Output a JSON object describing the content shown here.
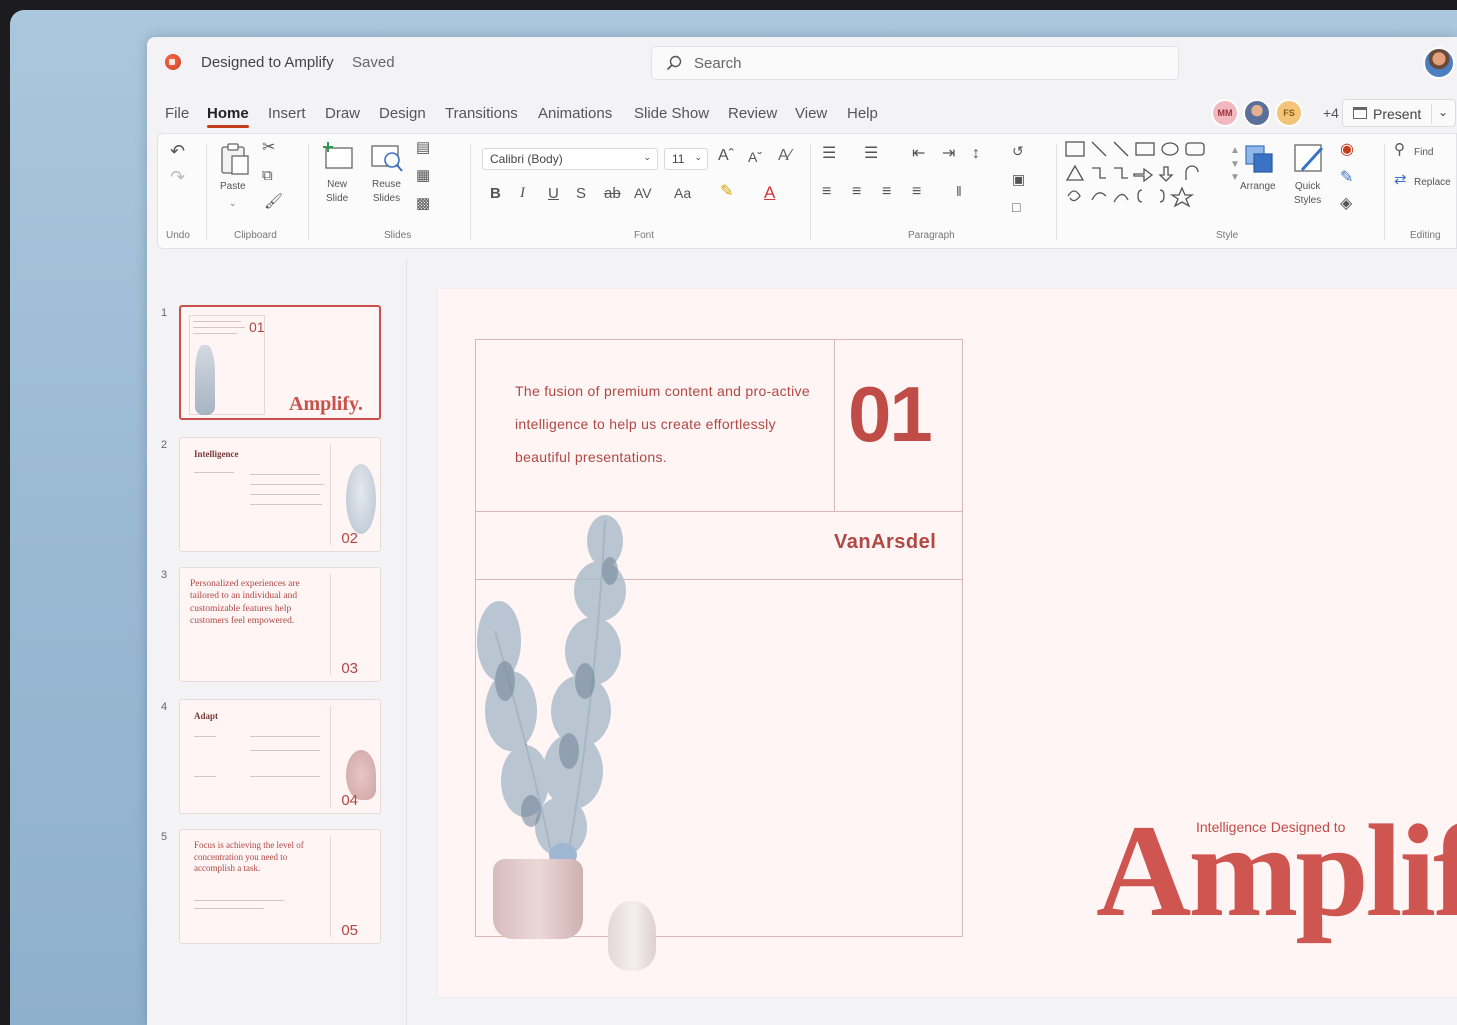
{
  "title_bar": {
    "document_title": "Designed to Amplify",
    "save_status": "Saved",
    "search_placeholder": "Search"
  },
  "tabs": [
    "File",
    "Home",
    "Insert",
    "Draw",
    "Design",
    "Transitions",
    "Animations",
    "Slide Show",
    "Review",
    "View",
    "Help"
  ],
  "active_tab": "Home",
  "collaborators": {
    "items": [
      {
        "initials": "MM",
        "color": "#f1b9bf"
      },
      {
        "initials": "",
        "color": "#9bb7e0"
      },
      {
        "initials": "FS",
        "color": "#f3c47a"
      }
    ],
    "more": "+4"
  },
  "present_label": "Present",
  "ribbon": {
    "groups": {
      "undo": "Undo",
      "clipboard": "Clipboard",
      "slides": "Slides",
      "font": "Font",
      "paragraph": "Paragraph",
      "style": "Style",
      "editing": "Editing"
    },
    "paste": "Paste",
    "new_slide": [
      "New",
      "Slide"
    ],
    "reuse_slides": [
      "Reuse",
      "Slides"
    ],
    "font_name": "Calibri (Body)",
    "font_size": "11",
    "arrange": "Arrange",
    "quick_styles": [
      "Quick",
      "Styles"
    ],
    "find": "Find",
    "replace": "Replace",
    "format_buttons": [
      "B",
      "I",
      "U",
      "S"
    ]
  },
  "slides": [
    {
      "number": "1",
      "label": "01",
      "title": "Amplify."
    },
    {
      "number": "2",
      "label": "02",
      "title": "Intelligence"
    },
    {
      "number": "3",
      "label": "03",
      "title": "Personalized experiences are tailored to an individual and customizable features help customers feel empowered."
    },
    {
      "number": "4",
      "label": "04",
      "title": "Adapt"
    },
    {
      "number": "5",
      "label": "05",
      "title": "Focus is achieving the level of concentration you need to accomplish a task."
    }
  ],
  "main_slide": {
    "text": "The fusion of premium content and pro-active intelligence to help us create effortlessly beautiful presentations.",
    "number": "01",
    "brand": "VanArsdel",
    "tagline": "Intelligence Designed to",
    "headline": "Amplify."
  }
}
